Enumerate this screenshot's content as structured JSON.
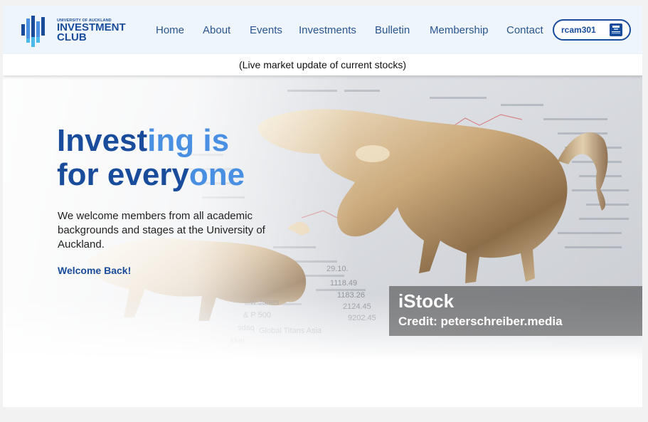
{
  "brand": {
    "university": "UNIVERSITY OF AUCKLAND",
    "name_line1": "INVESTMENT",
    "name_line2": "CLUB"
  },
  "nav": {
    "items": [
      {
        "label": "Home"
      },
      {
        "label": "About"
      },
      {
        "label": "Events"
      },
      {
        "label": "Investments"
      },
      {
        "label": "Bulletin"
      },
      {
        "label": "Membership"
      },
      {
        "label": "Contact"
      }
    ]
  },
  "user": {
    "username": "rcam301"
  },
  "ticker": {
    "text": "(Live market update of current stocks)"
  },
  "hero": {
    "title_part1": "Invest",
    "title_part1_accent": "ing is",
    "title_part2": "for every",
    "title_part2_accent": "one",
    "description": "We welcome members from all academic backgrounds and stages at the University of Auckland.",
    "welcome": "Welcome Back!"
  },
  "image_credit": {
    "brand": "iStock",
    "credit": "Credit: peterschreiber.media"
  },
  "colors": {
    "primary": "#1a4c9c",
    "accent": "#4a90e2",
    "header_bg": "#eef5fc"
  }
}
